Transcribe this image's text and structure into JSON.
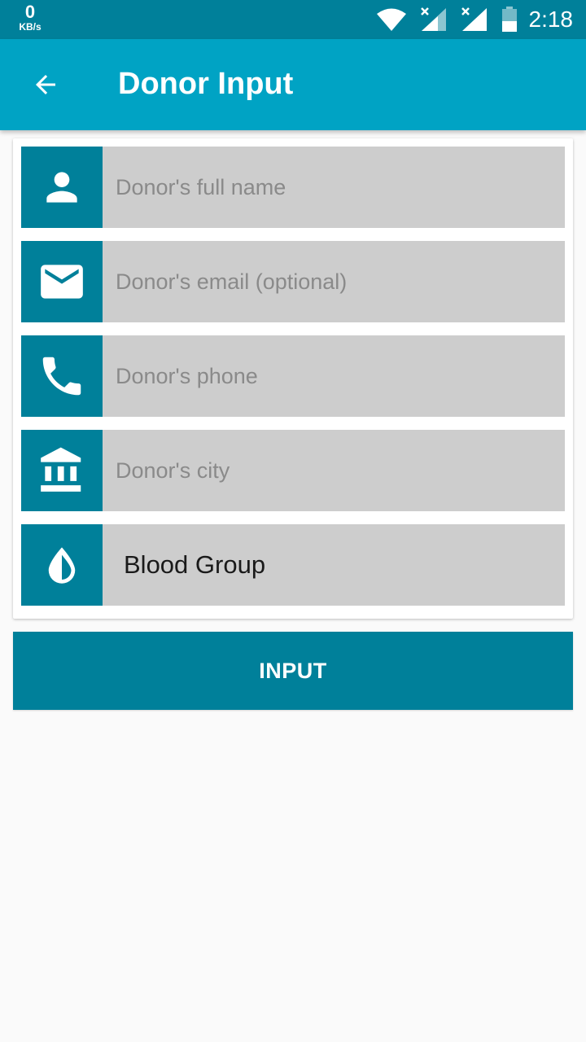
{
  "status_bar": {
    "net_speed_value": "0",
    "net_speed_unit": "KB/s",
    "time": "2:18",
    "icons": [
      "wifi-icon",
      "signal-sim1-icon",
      "signal-sim2-icon",
      "battery-icon"
    ]
  },
  "app_bar": {
    "back_icon": "arrow-back-icon",
    "title": "Donor Input"
  },
  "form": {
    "name": {
      "icon": "person-icon",
      "placeholder": "Donor's full name",
      "value": ""
    },
    "email": {
      "icon": "email-icon",
      "placeholder": "Donor's email (optional)",
      "value": ""
    },
    "phone": {
      "icon": "phone-icon",
      "placeholder": "Donor's phone",
      "value": ""
    },
    "city": {
      "icon": "institution-icon",
      "placeholder": "Donor's city",
      "value": ""
    },
    "blood_group": {
      "icon": "blood-drop-icon",
      "selected": "Blood Group"
    }
  },
  "submit_label": "INPUT",
  "colors": {
    "status_bar": "#00809a",
    "app_bar": "#00a3c4",
    "icon_box": "#00809a",
    "field_bg": "#cdcdcd",
    "button": "#00809a",
    "page_bg": "#fafafa"
  }
}
